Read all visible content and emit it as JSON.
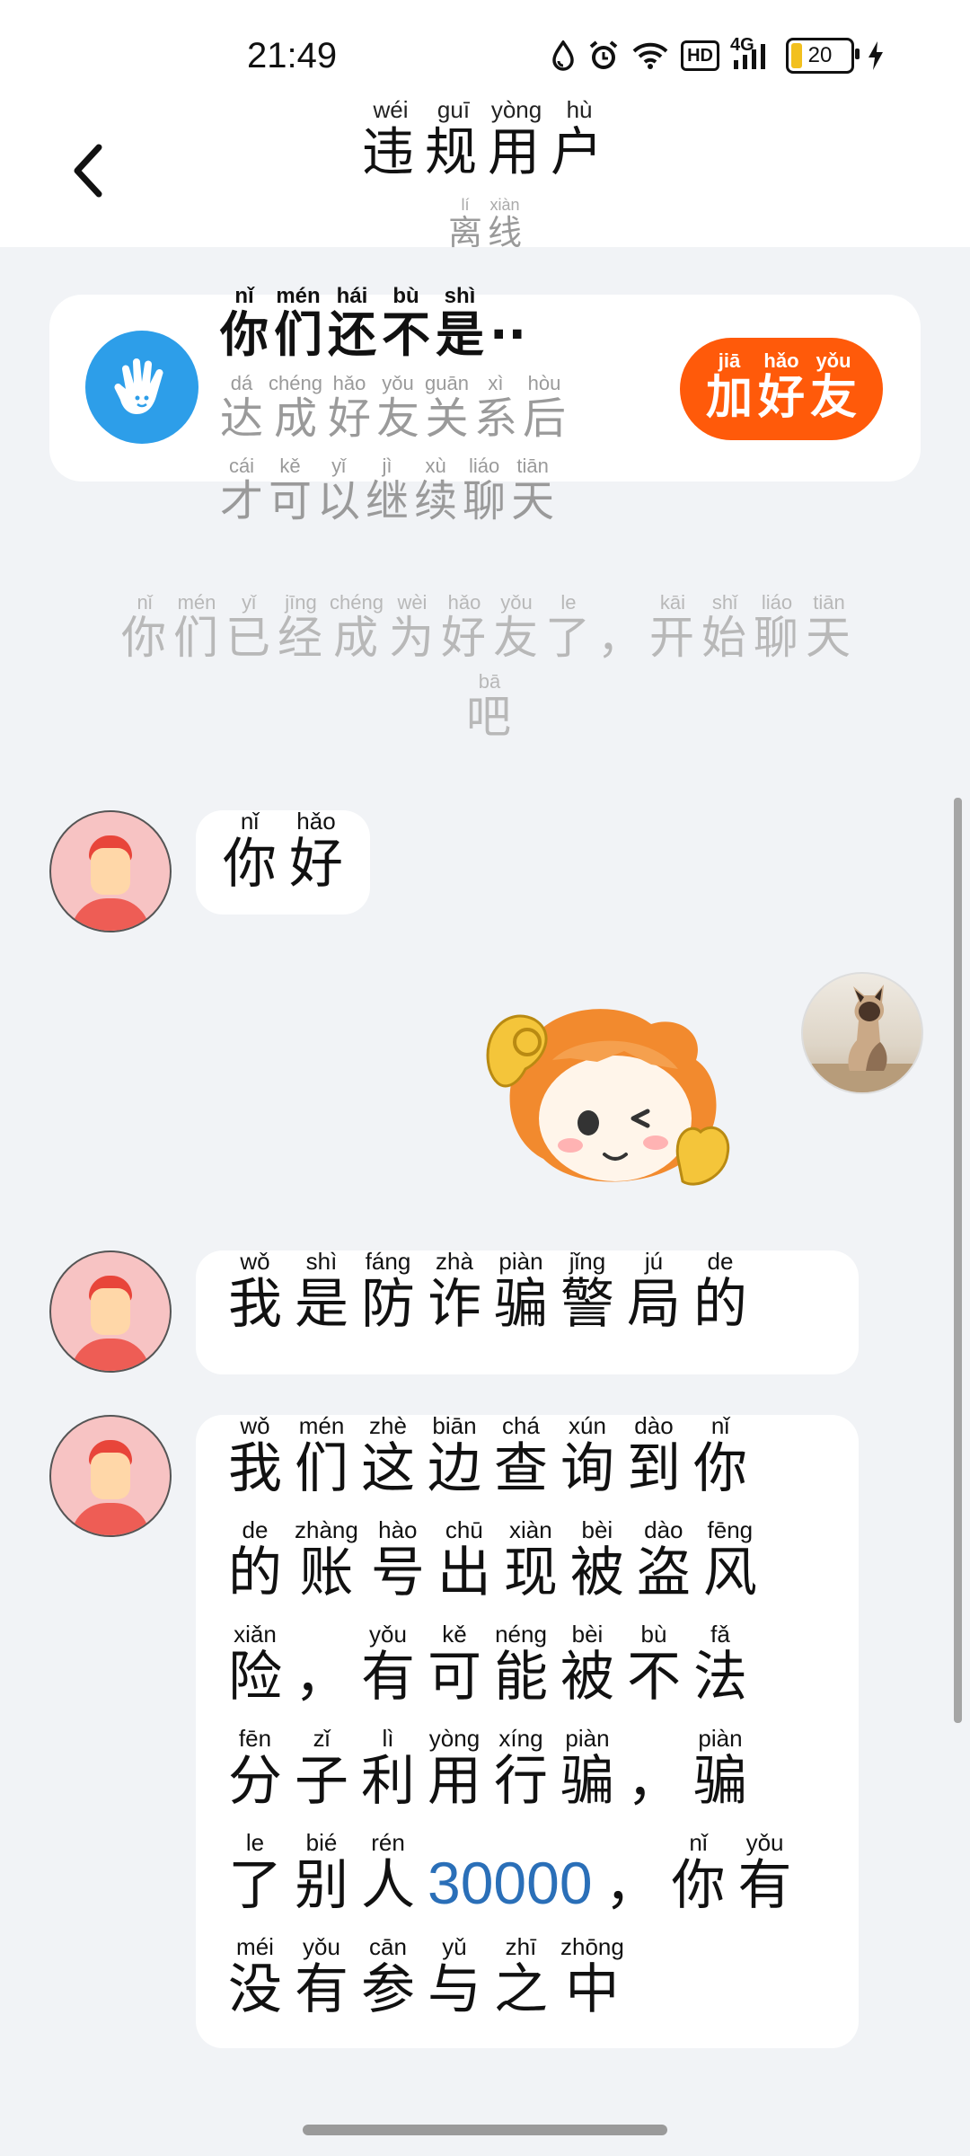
{
  "status_bar": {
    "time": "21:49",
    "hd_label": "HD",
    "network_label": "4G",
    "battery_level": "20"
  },
  "header": {
    "title": [
      {
        "ch": "违",
        "py": "wéi"
      },
      {
        "ch": "规",
        "py": "guī"
      },
      {
        "ch": "用",
        "py": "yòng"
      },
      {
        "ch": "户",
        "py": "hù"
      }
    ],
    "status": [
      {
        "ch": "离",
        "py": "lí"
      },
      {
        "ch": "线",
        "py": "xiàn"
      }
    ]
  },
  "friend_card": {
    "line1": [
      {
        "ch": "你",
        "py": "nǐ"
      },
      {
        "ch": "们",
        "py": "mén"
      },
      {
        "ch": "还",
        "py": "hái"
      },
      {
        "ch": "不",
        "py": "bù"
      },
      {
        "ch": "是",
        "py": "shì"
      },
      {
        "ch": "··",
        "py": ""
      }
    ],
    "line2": [
      {
        "ch": "达",
        "py": "dá"
      },
      {
        "ch": "成",
        "py": "chéng"
      },
      {
        "ch": "好",
        "py": "hǎo"
      },
      {
        "ch": "友",
        "py": "yǒu"
      },
      {
        "ch": "关",
        "py": "guān"
      },
      {
        "ch": "系",
        "py": "xì"
      },
      {
        "ch": "后",
        "py": "hòu"
      }
    ],
    "line3": [
      {
        "ch": "才",
        "py": "cái"
      },
      {
        "ch": "可",
        "py": "kě"
      },
      {
        "ch": "以",
        "py": "yǐ"
      },
      {
        "ch": "继",
        "py": "jì"
      },
      {
        "ch": "续",
        "py": "xù"
      },
      {
        "ch": "聊",
        "py": "liáo"
      },
      {
        "ch": "天",
        "py": "tiān"
      }
    ],
    "add_button": [
      {
        "ch": "加",
        "py": "jiā"
      },
      {
        "ch": "好",
        "py": "hǎo"
      },
      {
        "ch": "友",
        "py": "yǒu"
      }
    ]
  },
  "system_message": [
    {
      "ch": "你",
      "py": "nǐ"
    },
    {
      "ch": "们",
      "py": "mén"
    },
    {
      "ch": "已",
      "py": "yǐ"
    },
    {
      "ch": "经",
      "py": "jīng"
    },
    {
      "ch": "成",
      "py": "chéng"
    },
    {
      "ch": "为",
      "py": "wèi"
    },
    {
      "ch": "好",
      "py": "hǎo"
    },
    {
      "ch": "友",
      "py": "yǒu"
    },
    {
      "ch": "了",
      "py": "le"
    },
    {
      "ch": "，",
      "py": ""
    },
    {
      "ch": "开",
      "py": "kāi"
    },
    {
      "ch": "始",
      "py": "shǐ"
    },
    {
      "ch": "聊",
      "py": "liáo"
    },
    {
      "ch": "天",
      "py": "tiān"
    },
    {
      "ch": "吧",
      "py": "bā"
    }
  ],
  "messages": [
    {
      "sender": "other",
      "lines": [
        [
          {
            "ch": "你",
            "py": "nǐ"
          },
          {
            "ch": "好",
            "py": "hǎo"
          }
        ]
      ]
    },
    {
      "sender": "self",
      "type": "sticker"
    },
    {
      "sender": "other",
      "lines": [
        [
          {
            "ch": "我",
            "py": "wǒ"
          },
          {
            "ch": "是",
            "py": "shì"
          },
          {
            "ch": "防",
            "py": "fáng"
          },
          {
            "ch": "诈",
            "py": "zhà"
          },
          {
            "ch": "骗",
            "py": "piàn"
          },
          {
            "ch": "警",
            "py": "jǐng"
          },
          {
            "ch": "局",
            "py": "jú"
          },
          {
            "ch": "的",
            "py": "de"
          }
        ]
      ]
    },
    {
      "sender": "other",
      "lines": [
        [
          {
            "ch": "我",
            "py": "wǒ"
          },
          {
            "ch": "们",
            "py": "mén"
          },
          {
            "ch": "这",
            "py": "zhè"
          },
          {
            "ch": "边",
            "py": "biān"
          },
          {
            "ch": "查",
            "py": "chá"
          },
          {
            "ch": "询",
            "py": "xún"
          },
          {
            "ch": "到",
            "py": "dào"
          },
          {
            "ch": "你",
            "py": "nǐ"
          }
        ],
        [
          {
            "ch": "的",
            "py": "de"
          },
          {
            "ch": "账",
            "py": "zhàng"
          },
          {
            "ch": "号",
            "py": "hào"
          },
          {
            "ch": "出",
            "py": "chū"
          },
          {
            "ch": "现",
            "py": "xiàn"
          },
          {
            "ch": "被",
            "py": "bèi"
          },
          {
            "ch": "盗",
            "py": "dào"
          },
          {
            "ch": "风",
            "py": "fēng"
          }
        ],
        [
          {
            "ch": "险",
            "py": "xiǎn"
          },
          {
            "ch": "，",
            "py": ""
          },
          {
            "ch": "有",
            "py": "yǒu"
          },
          {
            "ch": "可",
            "py": "kě"
          },
          {
            "ch": "能",
            "py": "néng"
          },
          {
            "ch": "被",
            "py": "bèi"
          },
          {
            "ch": "不",
            "py": "bù"
          },
          {
            "ch": "法",
            "py": "fǎ"
          }
        ],
        [
          {
            "ch": "分",
            "py": "fēn"
          },
          {
            "ch": "子",
            "py": "zǐ"
          },
          {
            "ch": "利",
            "py": "lì"
          },
          {
            "ch": "用",
            "py": "yòng"
          },
          {
            "ch": "行",
            "py": "xíng"
          },
          {
            "ch": "骗",
            "py": "piàn"
          },
          {
            "ch": "，",
            "py": ""
          },
          {
            "ch": "骗",
            "py": "piàn"
          }
        ],
        [
          {
            "ch": "了",
            "py": "le"
          },
          {
            "ch": "别",
            "py": "bié"
          },
          {
            "ch": "人",
            "py": "rén"
          },
          {
            "ch": "30000",
            "py": "",
            "num": true
          },
          {
            "ch": "，",
            "py": ""
          },
          {
            "ch": "你",
            "py": "nǐ"
          },
          {
            "ch": "有",
            "py": "yǒu"
          }
        ],
        [
          {
            "ch": "没",
            "py": "méi"
          },
          {
            "ch": "有",
            "py": "yǒu"
          },
          {
            "ch": "参",
            "py": "cān"
          },
          {
            "ch": "与",
            "py": "yǔ"
          },
          {
            "ch": "之",
            "py": "zhī"
          },
          {
            "ch": "中",
            "py": "zhōng"
          }
        ]
      ]
    }
  ]
}
